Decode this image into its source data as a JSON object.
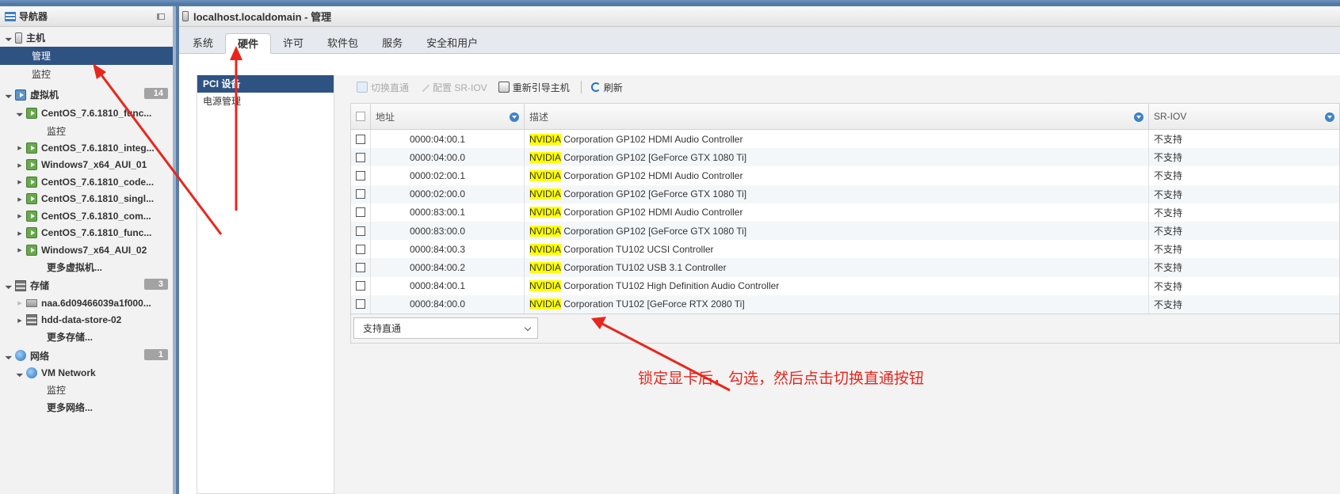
{
  "navigator": {
    "title": "导航器",
    "host": {
      "label": "主机",
      "children": [
        "管理",
        "监控"
      ]
    },
    "vms": {
      "label": "虚拟机",
      "count": "14",
      "items": [
        "CentOS_7.6.1810_func...",
        "CentOS_7.6.1810_integ...",
        "Windows7_x64_AUI_01",
        "CentOS_7.6.1810_code...",
        "CentOS_7.6.1810_singl...",
        "CentOS_7.6.1810_com...",
        "CentOS_7.6.1810_func...",
        "Windows7_x64_AUI_02"
      ],
      "first_child": "监控",
      "more": "更多虚拟机..."
    },
    "storage": {
      "label": "存储",
      "count": "3",
      "items": [
        "naa.6d09466039a1f000...",
        "hdd-data-store-02"
      ],
      "more": "更多存储..."
    },
    "network": {
      "label": "网络",
      "count": "1",
      "items": [
        "VM Network"
      ],
      "child": "监控",
      "more": "更多网络..."
    }
  },
  "main": {
    "title": "localhost.localdomain - 管理",
    "tabs": [
      "系统",
      "硬件",
      "许可",
      "软件包",
      "服务",
      "安全和用户"
    ],
    "active_tab": "硬件",
    "subnav": [
      "PCI 设备",
      "电源管理"
    ],
    "toolbar": {
      "toggle_passthrough": "切换直通",
      "configure_sriov": "配置 SR-IOV",
      "reboot_host": "重新引导主机",
      "refresh": "刷新"
    },
    "grid": {
      "columns": [
        "地址",
        "描述",
        "SR-IOV"
      ],
      "rows": [
        {
          "address": "0000:04:00.1",
          "vendor": "NVIDIA",
          "desc": " Corporation GP102 HDMI Audio Controller",
          "sriov": "不支持"
        },
        {
          "address": "0000:04:00.0",
          "vendor": "NVIDIA",
          "desc": " Corporation GP102 [GeForce GTX 1080 Ti]",
          "sriov": "不支持"
        },
        {
          "address": "0000:02:00.1",
          "vendor": "NVIDIA",
          "desc": " Corporation GP102 HDMI Audio Controller",
          "sriov": "不支持"
        },
        {
          "address": "0000:02:00.0",
          "vendor": "NVIDIA",
          "desc": " Corporation GP102 [GeForce GTX 1080 Ti]",
          "sriov": "不支持"
        },
        {
          "address": "0000:83:00.1",
          "vendor": "NVIDIA",
          "desc": " Corporation GP102 HDMI Audio Controller",
          "sriov": "不支持"
        },
        {
          "address": "0000:83:00.0",
          "vendor": "NVIDIA",
          "desc": " Corporation GP102 [GeForce GTX 1080 Ti]",
          "sriov": "不支持"
        },
        {
          "address": "0000:84:00.3",
          "vendor": "NVIDIA",
          "desc": " Corporation TU102 UCSI Controller",
          "sriov": "不支持"
        },
        {
          "address": "0000:84:00.2",
          "vendor": "NVIDIA",
          "desc": " Corporation TU102 USB 3.1 Controller",
          "sriov": "不支持"
        },
        {
          "address": "0000:84:00.1",
          "vendor": "NVIDIA",
          "desc": " Corporation TU102 High Definition Audio Controller",
          "sriov": "不支持"
        },
        {
          "address": "0000:84:00.0",
          "vendor": "NVIDIA",
          "desc": " Corporation TU102 [GeForce RTX 2080 Ti]",
          "sriov": "不支持"
        }
      ],
      "filter_value": "支持直通"
    }
  },
  "annotation": "锁定显卡后，勾选，然后点击切换直通按钮",
  "colors": {
    "selection": "#2e5383",
    "highlight": "#ffff00",
    "annotation": "#e8261d"
  }
}
